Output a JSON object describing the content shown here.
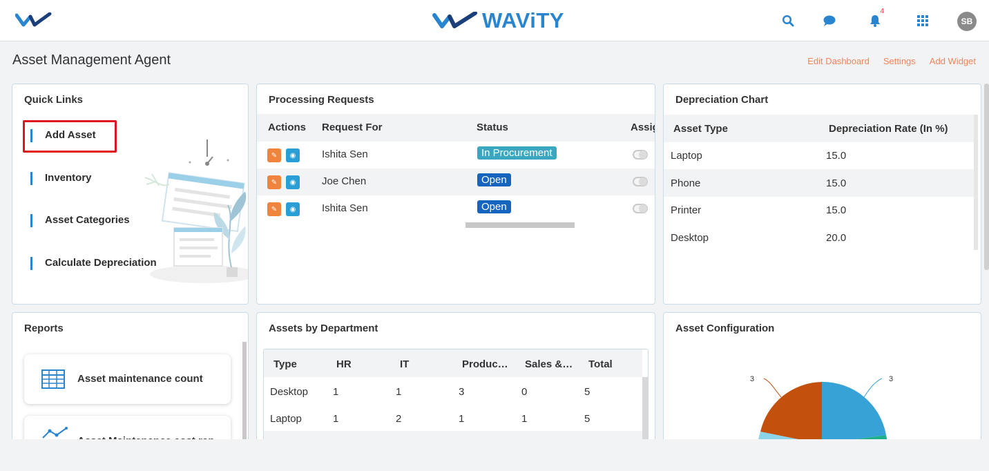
{
  "brand": {
    "name": "WAViTY"
  },
  "topbar": {
    "notification_count": "4",
    "avatar_initials": "SB"
  },
  "page": {
    "title": "Asset Management Agent",
    "actions": [
      "Edit Dashboard",
      "Settings",
      "Add Widget"
    ]
  },
  "quick_links": {
    "title": "Quick Links",
    "items": [
      "Add Asset",
      "Inventory",
      "Asset Categories",
      "Calculate Depreciation"
    ]
  },
  "processing_requests": {
    "title": "Processing Requests",
    "columns": [
      "Actions",
      "Request For",
      "Status",
      "Assig"
    ],
    "rows": [
      {
        "request_for": "Ishita Sen",
        "status": "In Procurement",
        "status_color": "#3aa7c0"
      },
      {
        "request_for": "Joe Chen",
        "status": "Open",
        "status_color": "#1565c0"
      },
      {
        "request_for": "Ishita Sen",
        "status": "Open",
        "status_color": "#1565c0"
      }
    ]
  },
  "depreciation": {
    "title": "Depreciation Chart",
    "columns": [
      "Asset Type",
      "Depreciation Rate (In %)"
    ],
    "rows": [
      [
        "Laptop",
        "15.0"
      ],
      [
        "Phone",
        "15.0"
      ],
      [
        "Printer",
        "15.0"
      ],
      [
        "Desktop",
        "20.0"
      ]
    ]
  },
  "reports": {
    "title": "Reports",
    "cards": [
      "Asset maintenance count",
      "Asset Maintenance cost rep"
    ]
  },
  "assets_by_department": {
    "title": "Assets by Department",
    "columns": [
      "Type",
      "HR",
      "IT",
      "Produc…",
      "Sales &…",
      "Total"
    ],
    "rows": [
      [
        "Desktop",
        "1",
        "1",
        "3",
        "0",
        "5"
      ],
      [
        "Laptop",
        "1",
        "2",
        "1",
        "1",
        "5"
      ]
    ]
  },
  "asset_configuration": {
    "title": "Asset Configuration",
    "pie_labels": [
      "3",
      "3"
    ]
  },
  "colors": {
    "accent": "#2a85d0",
    "link_orange": "#f0845a",
    "pie_orange": "#c4500d",
    "pie_blue": "#37a2d5",
    "pie_green": "#1db08a",
    "pie_light": "#8ad3e8"
  }
}
